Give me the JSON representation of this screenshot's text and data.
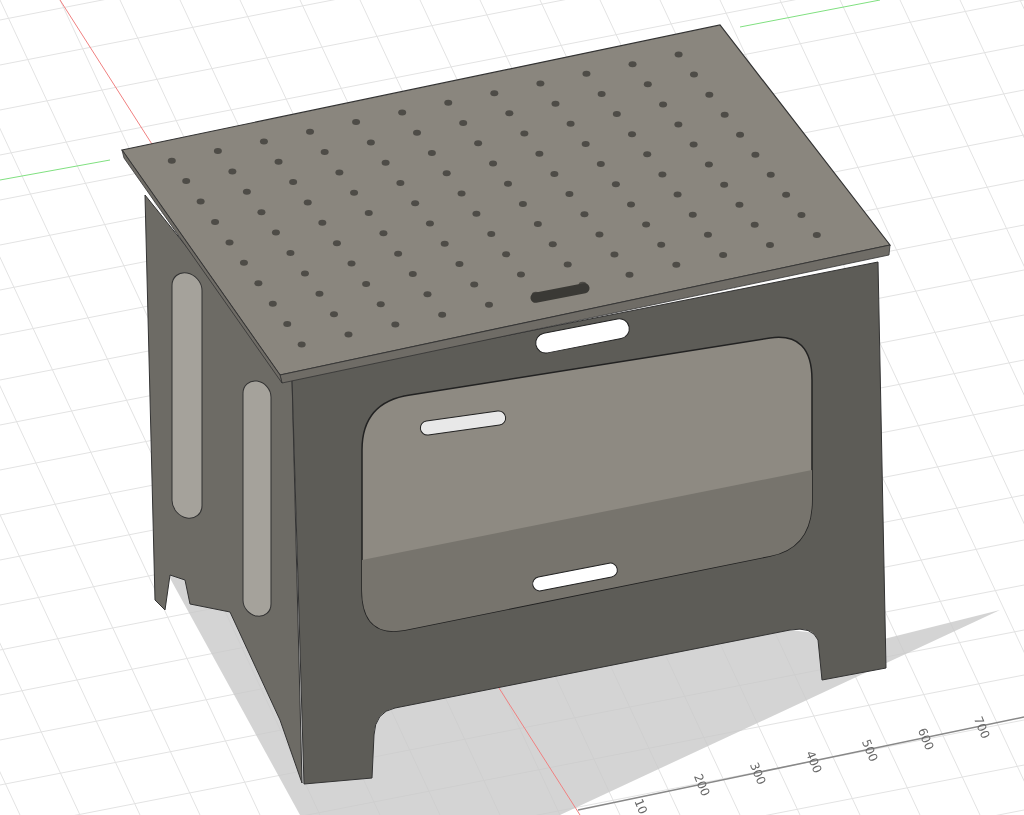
{
  "viewport": {
    "ruler_labels": [
      "10",
      "200",
      "300",
      "400",
      "500",
      "600",
      "700"
    ]
  }
}
